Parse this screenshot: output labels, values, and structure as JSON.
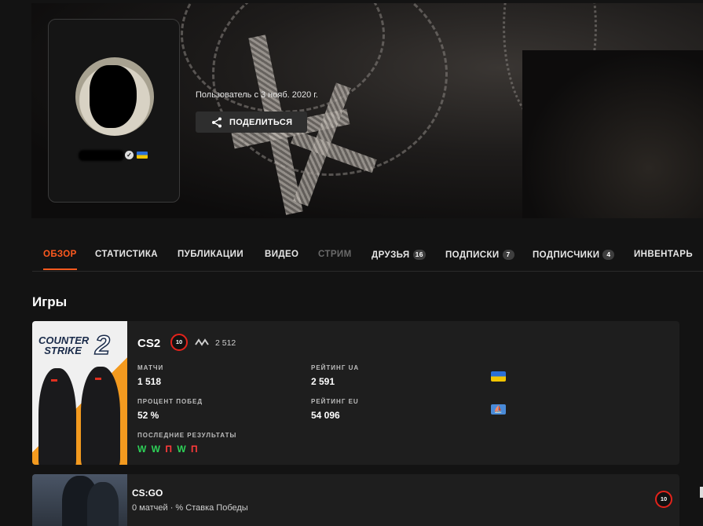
{
  "profile": {
    "member_since": "Пользователь с 3 нояб. 2020 г.",
    "share_label": "ПОДЕЛИТЬСЯ"
  },
  "nav": {
    "items": [
      {
        "label": "ОБЗОР"
      },
      {
        "label": "СТАТИСТИКА"
      },
      {
        "label": "ПУБЛИКАЦИИ"
      },
      {
        "label": "ВИДЕО"
      },
      {
        "label": "СТРИМ"
      },
      {
        "label": "ДРУЗЬЯ",
        "badge": "16"
      },
      {
        "label": "ПОДПИСКИ",
        "badge": "7"
      },
      {
        "label": "ПОДПИСЧИКИ",
        "badge": "4"
      },
      {
        "label": "ИНВЕНТАРЬ"
      }
    ]
  },
  "games_section": {
    "title": "Игры",
    "cs2": {
      "cover_logo_line1": "COUNTER",
      "cover_logo_line2": "STRIKE",
      "cover_logo_num": "2",
      "title": "CS2",
      "level": "10",
      "elo": "2 512",
      "matches_label": "МАТЧИ",
      "matches_value": "1 518",
      "winrate_label": "ПРОЦЕНТ ПОБЕД",
      "winrate_value": "52 %",
      "rating_ua_label": "РЕЙТИНГ UA",
      "rating_ua_value": "2 591",
      "rating_eu_label": "РЕЙТИНГ EU",
      "rating_eu_value": "54 096",
      "last_results_label": "ПОСЛЕДНИЕ РЕЗУЛЬТАТЫ",
      "last_results": [
        "W",
        "W",
        "П",
        "W",
        "П"
      ]
    },
    "csgo": {
      "title": "CS:GO",
      "subtitle": "0 матчей · % Ставка Победы",
      "level": "10"
    }
  },
  "colors": {
    "accent": "#ff5a1f",
    "win": "#2ed158",
    "loss": "#ff3b3b",
    "level_ring": "#e4231b"
  }
}
